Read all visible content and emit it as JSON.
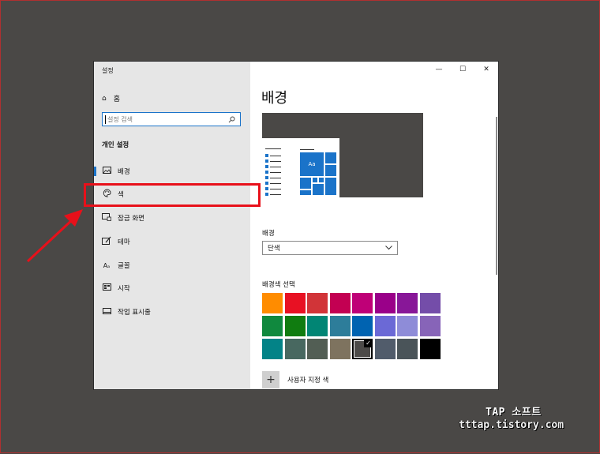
{
  "window": {
    "title": "설정",
    "controls": [
      "—",
      "☐",
      "✕"
    ]
  },
  "sidebar": {
    "home_label": "홈",
    "search_placeholder": "설정 검색",
    "section_title": "개인 설정",
    "items": [
      {
        "label": "배경",
        "icon": "image-icon"
      },
      {
        "label": "색",
        "icon": "palette-icon"
      },
      {
        "label": "잠금 화면",
        "icon": "lock-screen-icon"
      },
      {
        "label": "테마",
        "icon": "theme-icon"
      },
      {
        "label": "글꼴",
        "icon": "font-icon"
      },
      {
        "label": "시작",
        "icon": "start-icon"
      },
      {
        "label": "작업 표시줄",
        "icon": "taskbar-icon"
      }
    ],
    "active_item": "배경"
  },
  "main": {
    "title": "배경",
    "preview_tile_text": "Aa",
    "background_label": "배경",
    "background_value": "단색",
    "color_label": "배경색 선택",
    "custom_color_label": "사용자 지정 색",
    "swatch_colors": [
      [
        "#ff8c00",
        "#e81123",
        "#d13438",
        "#c30052",
        "#bf0077",
        "#9a0089",
        "#881798",
        "#744da9"
      ],
      [
        "#10893e",
        "#107c10",
        "#018574",
        "#2d7d9a",
        "#0063b1",
        "#6b69d6",
        "#8e8cd8",
        "#8764b8"
      ],
      [
        "#038387",
        "#486860",
        "#525e54",
        "#7e735f",
        "#4c4a48",
        "#515c6b",
        "#4a5459",
        "#000000"
      ]
    ],
    "selected_swatch": "#4c4a48"
  },
  "watermark": {
    "line1": "TAP 소프트",
    "line2": "tttap.tistory.com"
  }
}
